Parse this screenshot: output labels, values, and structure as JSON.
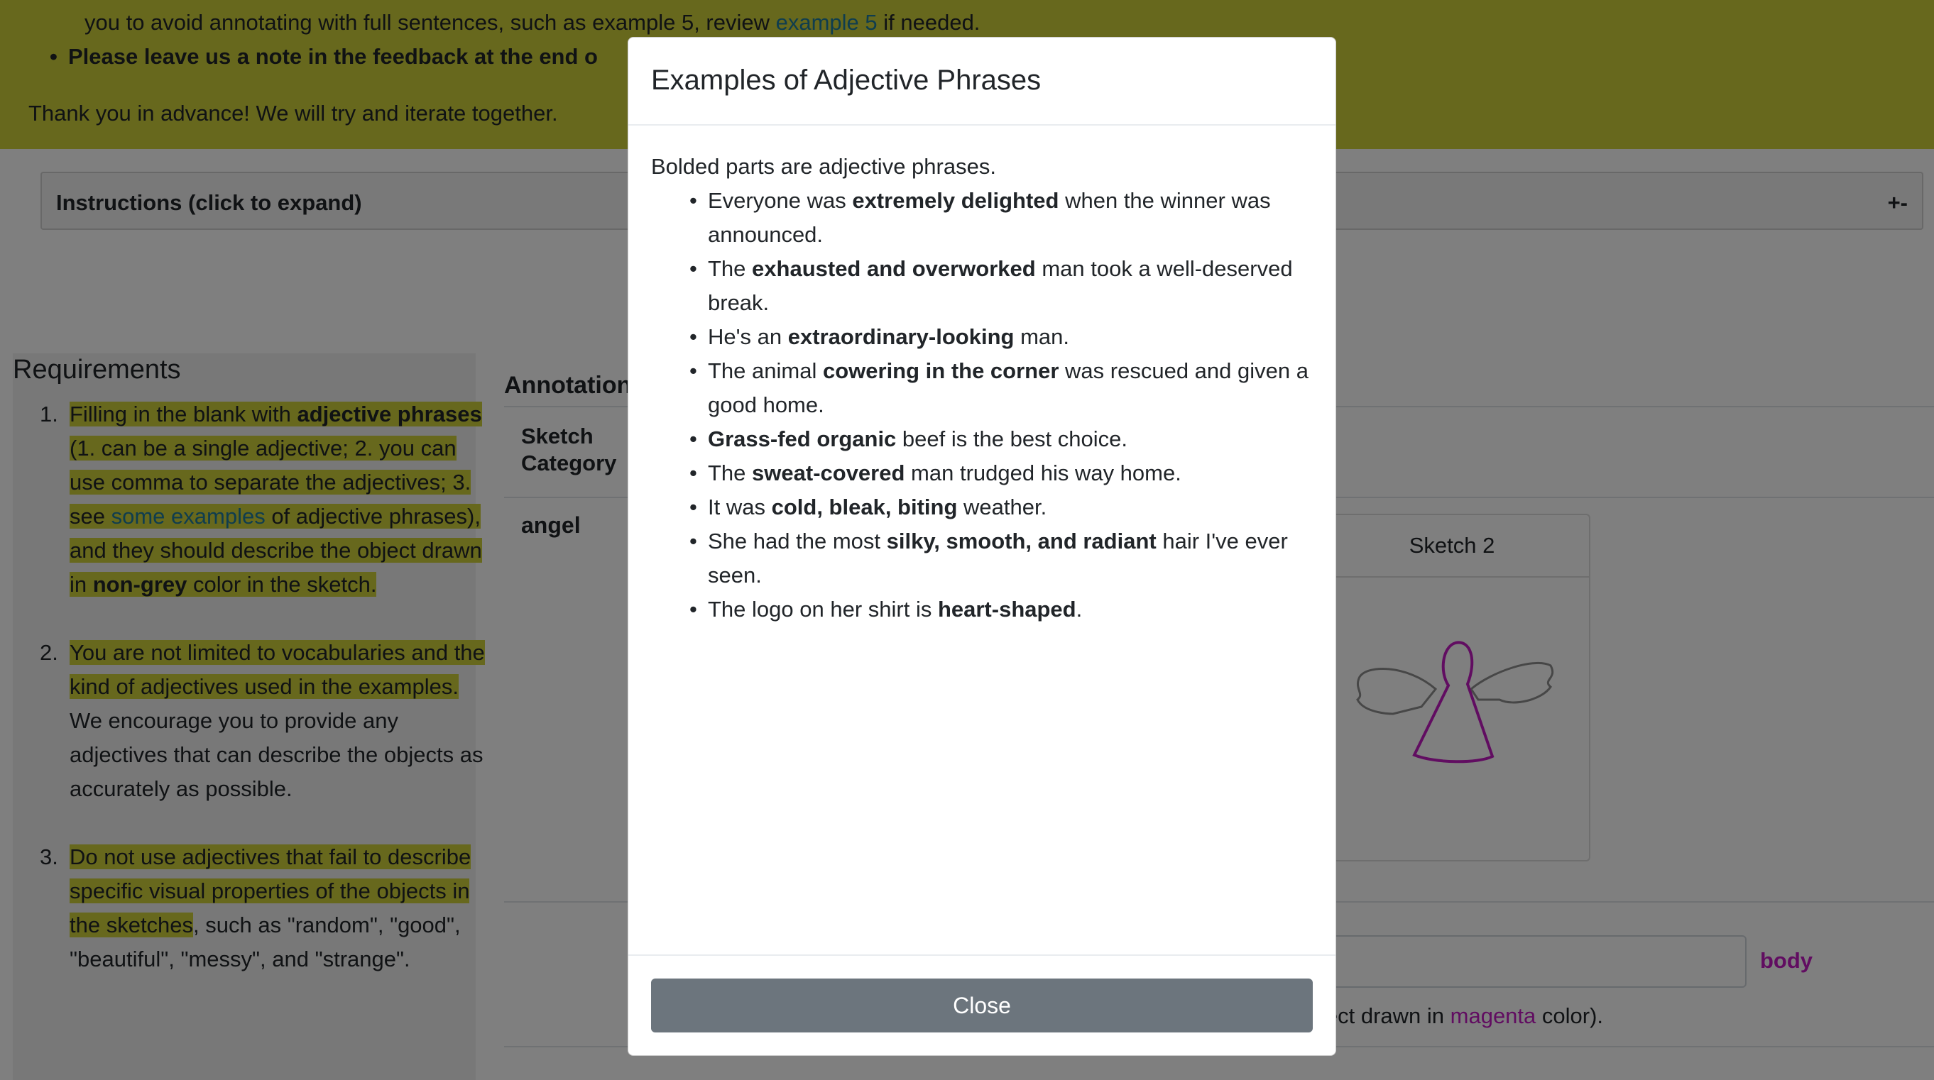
{
  "banner": {
    "line1_pre": "you to avoid annotating with full sentences, such as example 5, review ",
    "line1_link": "example 5",
    "line1_post": " if needed.",
    "line2": "Please leave us a note in the feedback at the end o",
    "line3": "Thank you in advance! We will try and iterate together."
  },
  "instructions": {
    "title": "Instructions (click to expand)",
    "toggle": "+-"
  },
  "requirements": {
    "heading": "Requirements",
    "items": [
      {
        "num": "1.",
        "t1": "Filling in the blank with ",
        "b1": "adjective phrases",
        "t2": " (1. can be a single adjective; 2. you can use comma to separate the adjectives; 3. see ",
        "link": "some examples",
        "t3": " of adjective phrases), and they should describe the object drawn in ",
        "b2": "non-grey",
        "t4": " color in the sketch."
      },
      {
        "num": "2.",
        "hl": "You are not limited to vocabularies and the kind of adjectives used in the examples.",
        "rest": " We encourage you to provide any adjectives that can describe the objects as accurately as possible."
      },
      {
        "num": "3.",
        "hl": "Do not use adjectives that fail to describe specific visual properties of the objects in the sketches",
        "rest": ", such as \"random\", \"good\", \"beautiful\", \"messy\", and \"strange\"."
      }
    ]
  },
  "annotation": {
    "title": "Annotation",
    "col_head": "Sketch Category",
    "category": "angel",
    "sketch2_label": "Sketch 2",
    "part_label": "body",
    "hint_pre": "ject drawn in ",
    "hint_color": "magenta",
    "hint_post": " color)."
  },
  "colors": {
    "banner": "#cfd13b",
    "magenta": "#c21bc2",
    "close_button": "#6c757d",
    "link": "#1f7a9c"
  },
  "modal": {
    "title": "Examples of Adjective Phrases",
    "intro": "Bolded parts are adjective phrases.",
    "examples": [
      {
        "pre": "Everyone was ",
        "bold": "extremely delighted",
        "post": " when the winner was announced."
      },
      {
        "pre": "The ",
        "bold": "exhausted and overworked",
        "post": " man took a well-deserved break."
      },
      {
        "pre": "He's an ",
        "bold": "extraordinary-looking",
        "post": " man."
      },
      {
        "pre": "The animal ",
        "bold": "cowering in the corner",
        "post": " was rescued and given a good home."
      },
      {
        "pre": "",
        "bold": "Grass-fed organic",
        "post": " beef is the best choice."
      },
      {
        "pre": "The ",
        "bold": "sweat-covered",
        "post": " man trudged his way home."
      },
      {
        "pre": "It was ",
        "bold": "cold, bleak, biting",
        "post": " weather."
      },
      {
        "pre": "She had the most ",
        "bold": "silky, smooth, and radiant",
        "post": " hair I've ever seen."
      },
      {
        "pre": "The logo on her shirt is ",
        "bold": "heart-shaped",
        "post": "."
      }
    ],
    "close_label": "Close"
  }
}
